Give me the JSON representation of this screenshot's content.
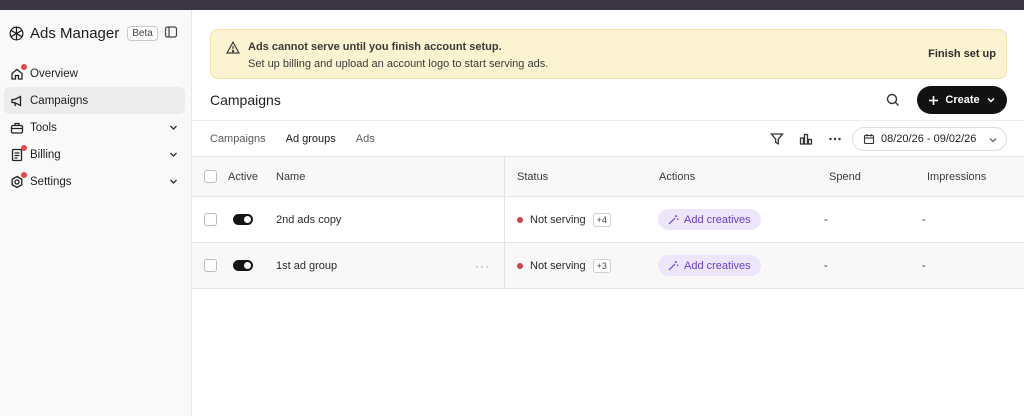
{
  "sidebar": {
    "brand": "Ads Manager",
    "badge": "Beta",
    "items": [
      {
        "label": "Overview",
        "icon": "house-icon",
        "has_dot": true,
        "has_chevron": false,
        "active": false
      },
      {
        "label": "Campaigns",
        "icon": "megaphone-icon",
        "has_dot": false,
        "has_chevron": false,
        "active": true
      },
      {
        "label": "Tools",
        "icon": "toolbox-icon",
        "has_dot": false,
        "has_chevron": true,
        "active": false
      },
      {
        "label": "Billing",
        "icon": "receipt-icon",
        "has_dot": true,
        "has_chevron": true,
        "active": false
      },
      {
        "label": "Settings",
        "icon": "gear-icon",
        "has_dot": true,
        "has_chevron": true,
        "active": false
      }
    ]
  },
  "banner": {
    "title": "Ads cannot serve until you finish account setup.",
    "subtitle": "Set up billing and upload an account logo to start serving ads.",
    "action": "Finish set up"
  },
  "header": {
    "title": "Campaigns",
    "create_label": "Create"
  },
  "tabs": [
    {
      "label": "Campaigns",
      "active": false
    },
    {
      "label": "Ad groups",
      "active": true
    },
    {
      "label": "Ads",
      "active": false
    }
  ],
  "date_range": "08/20/26 - 09/02/26",
  "table": {
    "columns": [
      "Active",
      "Name",
      "Status",
      "Actions",
      "Spend",
      "Impressions"
    ],
    "rows": [
      {
        "name": "2nd ads copy",
        "status": "Not serving",
        "status_count": "+4",
        "action": "Add creatives",
        "spend": "-",
        "impressions": "-"
      },
      {
        "name": "1st ad group",
        "status": "Not serving",
        "status_count": "+3",
        "action": "Add creatives",
        "spend": "-",
        "impressions": "-"
      }
    ]
  },
  "colors": {
    "accent": "#121212",
    "banner_bg": "#fcf3d2",
    "status_dot": "#d1434b",
    "pill_bg": "#ede6fb",
    "pill_text": "#6b3ed1"
  }
}
